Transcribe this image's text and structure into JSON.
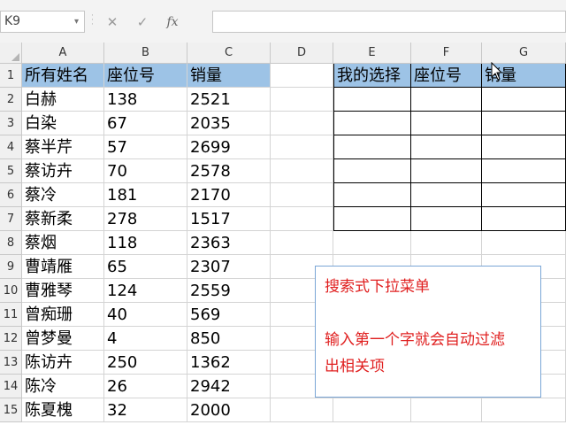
{
  "name_box": "K9",
  "name_box_caret": "▾",
  "formula_icons": {
    "cancel": "✕",
    "enter": "✓",
    "fx": "fx"
  },
  "columns": [
    "A",
    "B",
    "C",
    "D",
    "E",
    "F",
    "G"
  ],
  "rows": [
    "1",
    "2",
    "3",
    "4",
    "5",
    "6",
    "7",
    "8",
    "9",
    "10",
    "11",
    "12",
    "13",
    "14",
    "15"
  ],
  "headers_left": [
    "所有姓名",
    "座位号",
    "销量"
  ],
  "headers_right": [
    "我的选择",
    "座位号",
    "销量"
  ],
  "data_rows": [
    [
      "白赫",
      "138",
      "2521"
    ],
    [
      "白染",
      "67",
      "2035"
    ],
    [
      "蔡半芹",
      "57",
      "2699"
    ],
    [
      "蔡访卉",
      "70",
      "2578"
    ],
    [
      "蔡冷",
      "181",
      "2170"
    ],
    [
      "蔡新柔",
      "278",
      "1517"
    ],
    [
      "蔡烟",
      "118",
      "2363"
    ],
    [
      "曹靖雁",
      "65",
      "2307"
    ],
    [
      "曹雅琴",
      "124",
      "2559"
    ],
    [
      "曾痴珊",
      "40",
      "569"
    ],
    [
      "曾梦曼",
      "4",
      "850"
    ],
    [
      "陈访卉",
      "250",
      "1362"
    ],
    [
      "陈冷",
      "26",
      "2942"
    ],
    [
      "陈夏槐",
      "32",
      "2000"
    ]
  ],
  "note": {
    "line1": "搜索式下拉菜单",
    "line2": "输入第一个字就会自动过滤",
    "line3": "出相关项"
  },
  "colors": {
    "header_fill": "#9dc3e6",
    "note_text": "#e02020",
    "note_border": "#7aa6d6"
  }
}
